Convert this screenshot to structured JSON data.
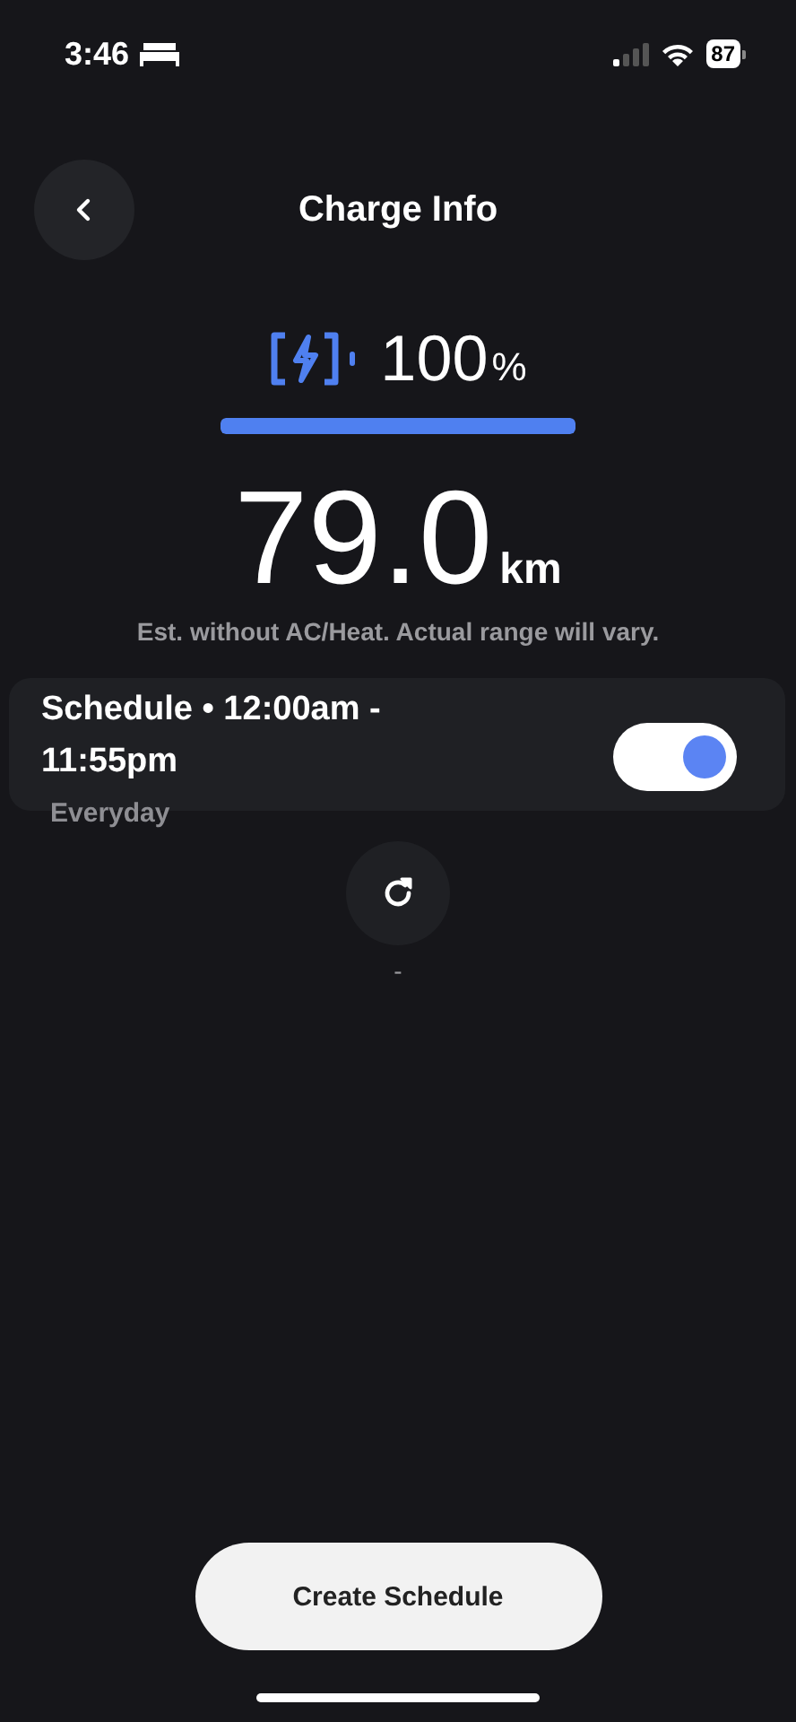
{
  "status_bar": {
    "time": "3:46",
    "battery": "87"
  },
  "header": {
    "title": "Charge Info"
  },
  "charge": {
    "percent": "100",
    "unit": "%",
    "level": 1.0
  },
  "range": {
    "value": "79.0",
    "unit": "km",
    "note": "Est. without AC/Heat. Actual range will vary."
  },
  "schedule": {
    "title": "Schedule • 12:00am - 11:55pm",
    "days": "Everyday",
    "on": true
  },
  "refresh": {
    "status": "-"
  },
  "create_button": "Create Schedule"
}
